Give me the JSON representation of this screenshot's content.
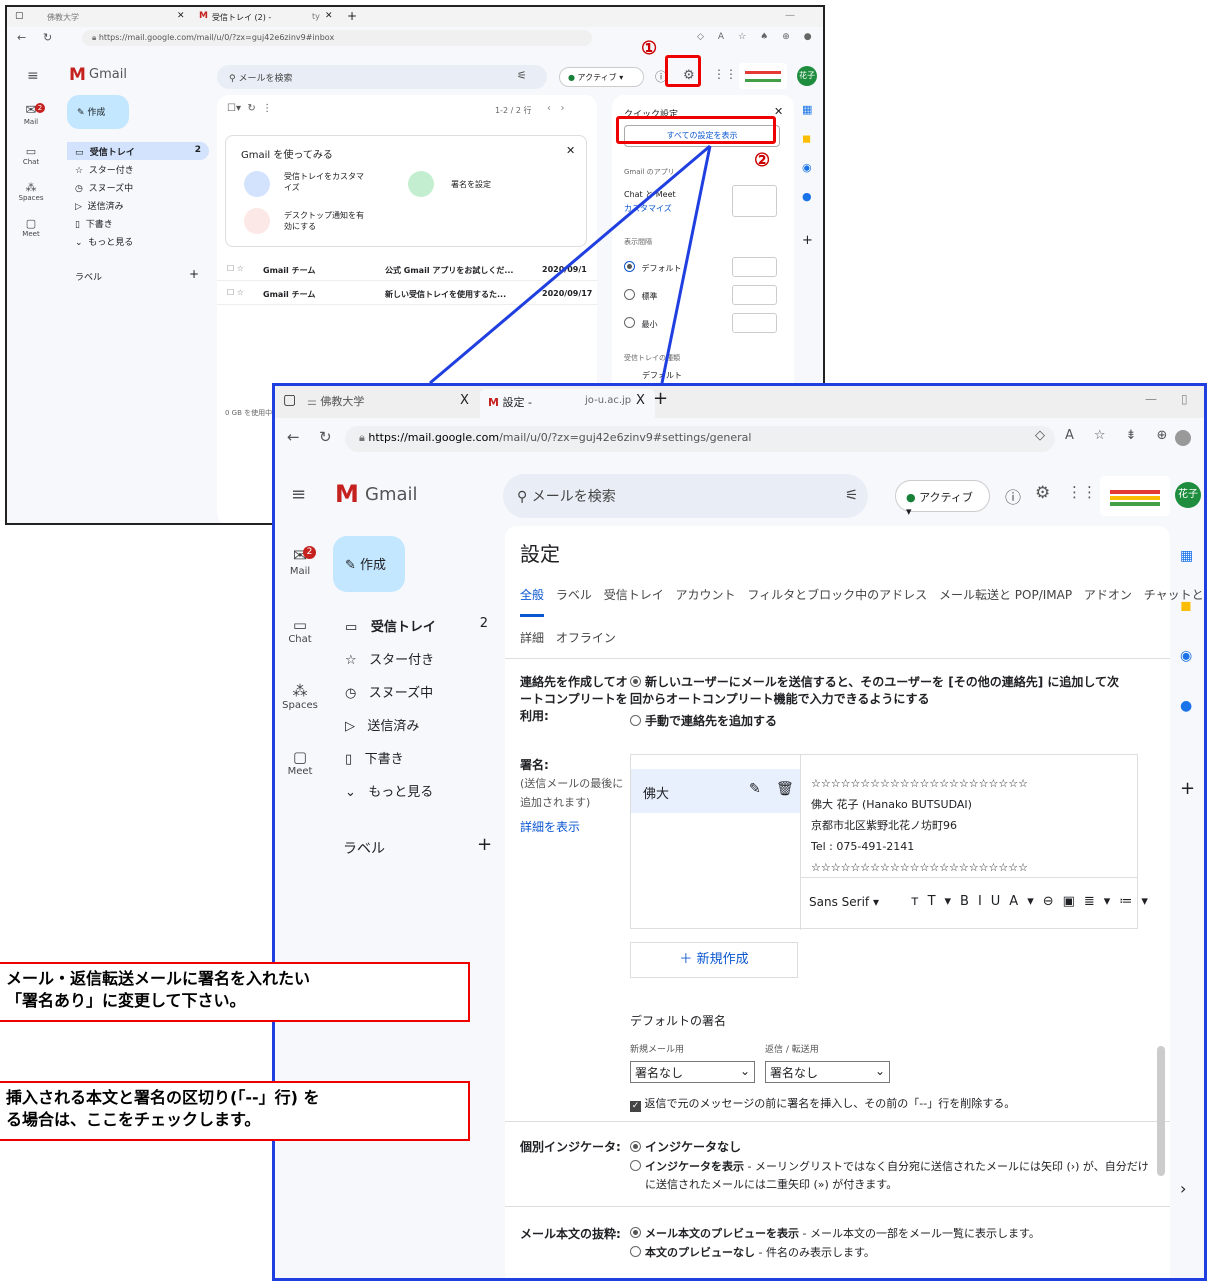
{
  "back": {
    "tab1": "佛教大学",
    "tab2": "受信トレイ (2) -",
    "tab2_suffix": "ty",
    "url": "https://mail.google.com/mail/u/0/?zx=guj42e6zinv9#inbox",
    "app_name": "Gmail",
    "search_placeholder": "メールを検索",
    "status": "アクティブ",
    "avatar": "花子",
    "compose": "作成",
    "rail": [
      "Mail",
      "Chat",
      "Spaces",
      "Meet"
    ],
    "mail_badge": "2",
    "nav": [
      {
        "label": "受信トレイ",
        "count": "2"
      },
      {
        "label": "スター付き",
        "count": ""
      },
      {
        "label": "スヌーズ中",
        "count": ""
      },
      {
        "label": "送信済み",
        "count": ""
      },
      {
        "label": "下書き",
        "count": ""
      },
      {
        "label": "もっと見る",
        "count": ""
      }
    ],
    "labels_heading": "ラベル",
    "pager": "1-2 / 2 行",
    "card_title": "Gmail を使ってみる",
    "card_items": [
      "受信トレイをカスタマイズ",
      "署名を設定",
      "デスクトップ通知を有効にする"
    ],
    "emails": [
      {
        "sender": "Gmail チーム",
        "subject": "公式 Gmail アプリをお試しくだ...",
        "date": "2020/09/1"
      },
      {
        "sender": "Gmail チーム",
        "subject": "新しい受信トレイを使用するた...",
        "date": "2020/09/17"
      }
    ],
    "storage": "0 GB を使用中",
    "quick_settings": {
      "title": "クイック設定",
      "all_settings": "すべての設定を表示",
      "apps_heading": "Gmail のアプリ",
      "chat_meet": "Chat と Meet",
      "customize": "カスタマイズ",
      "density_heading": "表示間隔",
      "density": [
        "デフォルト",
        "標準",
        "最小"
      ],
      "inbox_type_heading": "受信トレイの種類",
      "inbox_type_default": "デフォルト"
    }
  },
  "front": {
    "tab1": "佛教大学",
    "tab2": "設定 -",
    "tab2_suffix": "jo-u.ac.jp",
    "url_host": "https://mail.google.com",
    "url_path": "/mail/u/0/?zx=guj42e6zinv9#settings/general",
    "app_name": "Gmail",
    "search_placeholder": "メールを検索",
    "status": "アクティブ",
    "avatar": "花子",
    "compose": "作成",
    "rail": [
      "Mail",
      "Chat",
      "Spaces",
      "Meet"
    ],
    "mail_badge": "2",
    "nav": [
      {
        "label": "受信トレイ",
        "count": "2"
      },
      {
        "label": "スター付き",
        "count": ""
      },
      {
        "label": "スヌーズ中",
        "count": ""
      },
      {
        "label": "送信済み",
        "count": ""
      },
      {
        "label": "下書き",
        "count": ""
      },
      {
        "label": "もっと見る",
        "count": ""
      }
    ],
    "labels_heading": "ラベル",
    "settings_title": "設定",
    "tabs_row1": [
      "全般",
      "ラベル",
      "受信トレイ",
      "アカウント",
      "フィルタとブロック中のアドレス",
      "メール転送と POP/IMAP",
      "アドオン",
      "チャットと Meet"
    ],
    "tabs_row2": [
      "詳細",
      "オフライン"
    ],
    "autocomplete_label": "連絡先を作成してオートコンプリートを利用:",
    "autocomplete_opt1": "新しいユーザーにメールを送信すると、そのユーザーを [その他の連絡先] に追加して次回からオートコンプリート機能で入力できるようにする",
    "autocomplete_opt2": "手動で連絡先を追加する",
    "signature_label": "署名:",
    "signature_note": "(送信メールの最後に追加されます)",
    "signature_more": "詳細を表示",
    "signature_name": "佛大",
    "signature_lines": [
      "☆☆☆☆☆☆☆☆☆☆☆☆☆☆☆☆☆☆☆☆☆☆",
      "佛大 花子 (Hanako BUTSUDAI)",
      "京都市北区紫野北花ノ坊町96",
      "Tel : 075-491-2141",
      "☆☆☆☆☆☆☆☆☆☆☆☆☆☆☆☆☆☆☆☆☆☆"
    ],
    "font_name": "Sans Serif",
    "new_sig": "新規作成",
    "default_sig_heading": "デフォルトの署名",
    "new_mail_label": "新規メール用",
    "reply_label": "返信 / 転送用",
    "new_mail_value": "署名なし",
    "reply_value": "署名なし",
    "checkbox_text": "返信で元のメッセージの前に署名を挿入し、その前の「--」行を削除する。",
    "indicator_label": "個別インジケータ:",
    "indicator_opt1": "インジケータなし",
    "indicator_opt2_bold": "インジケータを表示",
    "indicator_opt2_rest": " - メーリングリストではなく自分宛に送信されたメールには矢印 (›) が、自分だけに送信されたメールには二重矢印 (») が付きます。",
    "snippet_label": "メール本文の抜粋:",
    "snippet_opt1_bold": "メール本文のプレビューを表示",
    "snippet_opt1_rest": " - メール本文の一部をメール一覧に表示します。",
    "snippet_opt2_bold": "本文のプレビューなし",
    "snippet_opt2_rest": " - 件名のみ表示します。"
  },
  "annotations": {
    "num1": "①",
    "num2": "②",
    "callout1_line1": "メール・返信転送メールに署名を入れたい",
    "callout1_line2": "「署名あり」に変更して下さい。",
    "callout2_line1": "挿入される本文と署名の区切り(「--」行) を",
    "callout2_line2": "る場合は、ここをチェックします。"
  },
  "colors": {
    "accent": "#0b57d0",
    "compose": "#c2e7ff",
    "annotation_red": "#e00000",
    "frame_blue": "#1f3fe0"
  }
}
